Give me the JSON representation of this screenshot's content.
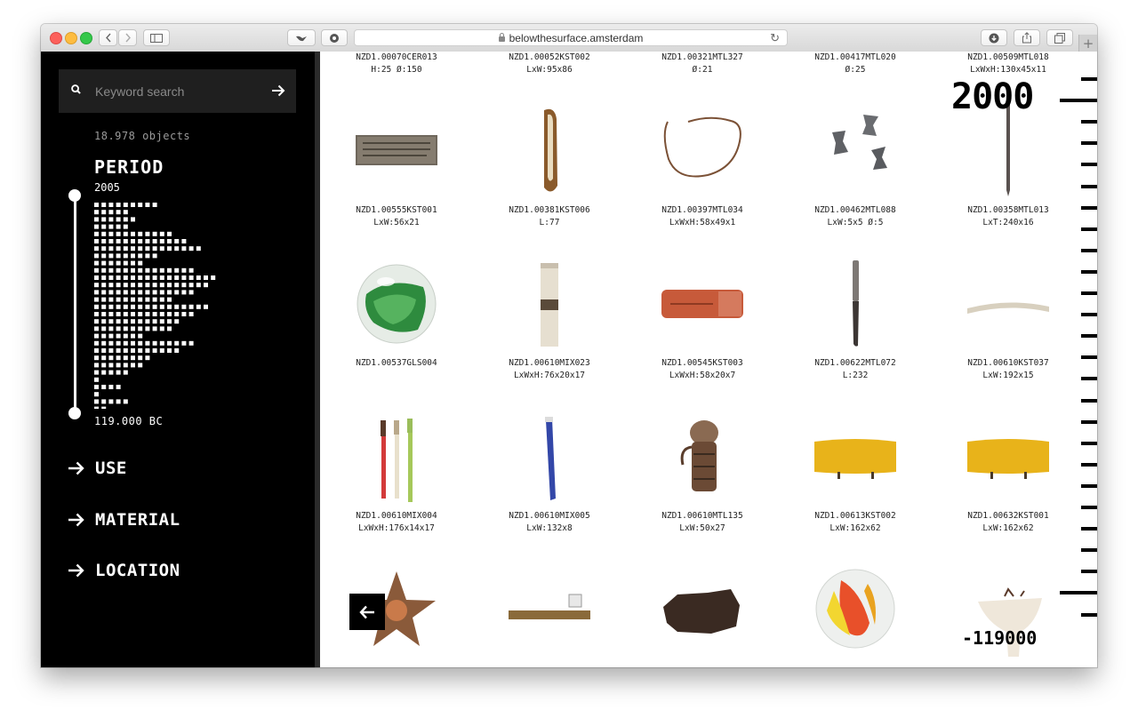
{
  "browser": {
    "url": "belowthesurface.amsterdam"
  },
  "search": {
    "placeholder": "Keyword search"
  },
  "count": "18.978 objects",
  "period": {
    "title": "PERIOD",
    "max_label": "2005",
    "min_label": "119.000 BC",
    "histogram_rows": [
      9,
      5,
      6,
      5,
      11,
      13,
      15,
      9,
      7,
      14,
      17,
      16,
      14,
      11,
      16,
      14,
      12,
      11,
      7,
      14,
      12,
      8,
      7,
      5,
      1,
      4,
      1,
      5,
      2
    ]
  },
  "nav": [
    {
      "label": "USE"
    },
    {
      "label": "MATERIAL"
    },
    {
      "label": "LOCATION"
    }
  ],
  "ruler": {
    "top_label": "2000",
    "bottom_label": "-119000"
  },
  "grid": {
    "header_row": [
      {
        "code": "NZD1.00070CER013",
        "dim": "H:25 Ø:150"
      },
      {
        "code": "NZD1.00052KST002",
        "dim": "LxW:95x86"
      },
      {
        "code": "NZD1.00321MTL327",
        "dim": "Ø:21"
      },
      {
        "code": "NZD1.00417MTL020",
        "dim": "Ø:25"
      },
      {
        "code": "NZD1.00509MTL018",
        "dim": "LxWxH:130x45x11"
      }
    ],
    "rows": [
      [
        {
          "code": "NZD1.00555KST001",
          "dim": "LxW:56x21",
          "icon": "plaque-icon"
        },
        {
          "code": "NZD1.00381KST006",
          "dim": "L:77",
          "icon": "wooden-handle-icon"
        },
        {
          "code": "NZD1.00397MTL034",
          "dim": "LxWxH:58x49x1",
          "icon": "wire-loop-icon"
        },
        {
          "code": "NZD1.00462MTL088",
          "dim": "LxW:5x5 Ø:5",
          "icon": "lead-weights-icon"
        },
        {
          "code": "NZD1.00358MTL013",
          "dim": "LxT:240x16",
          "icon": "nail-icon"
        }
      ],
      [
        {
          "code": "NZD1.00537GLS004",
          "dim": "",
          "icon": "green-marble-icon"
        },
        {
          "code": "NZD1.00610MIX023",
          "dim": "LxWxH:76x20x17",
          "icon": "tube-icon"
        },
        {
          "code": "NZD1.00545KST003",
          "dim": "LxWxH:58x20x7",
          "icon": "eraser-icon"
        },
        {
          "code": "NZD1.00622MTL072",
          "dim": "L:232",
          "icon": "knife-icon"
        },
        {
          "code": "NZD1.00610KST037",
          "dim": "LxW:192x15",
          "icon": "bone-icon"
        }
      ],
      [
        {
          "code": "NZD1.00610MIX004",
          "dim": "LxWxH:176x14x17",
          "icon": "toothbrushes-icon"
        },
        {
          "code": "NZD1.00610MIX005",
          "dim": "LxW:132x8",
          "icon": "pen-icon"
        },
        {
          "code": "NZD1.00610MTL135",
          "dim": "LxW:50x27",
          "icon": "corroded-lock-icon"
        },
        {
          "code": "NZD1.00613KST002",
          "dim": "LxW:162x62",
          "icon": "yellow-clip-icon"
        },
        {
          "code": "NZD1.00632KST001",
          "dim": "LxW:162x62",
          "icon": "yellow-clip-icon"
        }
      ],
      [
        {
          "code": "",
          "dim": "",
          "icon": "star-badge-icon"
        },
        {
          "code": "",
          "dim": "",
          "icon": "strap-icon"
        },
        {
          "code": "",
          "dim": "",
          "icon": "leather-scrap-icon"
        },
        {
          "code": "",
          "dim": "",
          "icon": "orange-marble-icon"
        },
        {
          "code": "",
          "dim": "",
          "icon": "pipe-bowl-icon"
        }
      ]
    ]
  }
}
